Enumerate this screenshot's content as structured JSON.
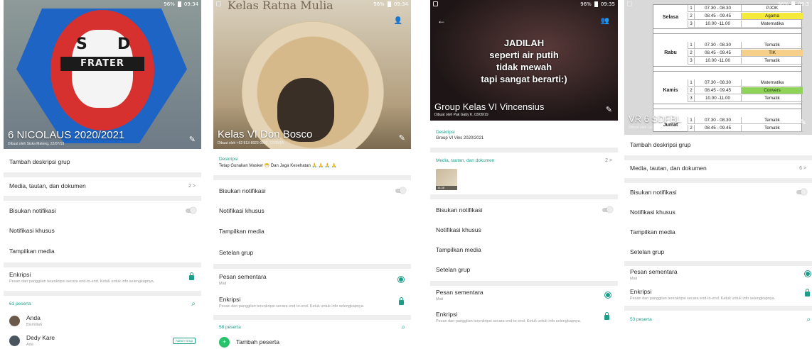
{
  "status": {
    "p1": "96%",
    "p1_time": "09:34",
    "p2": "96%",
    "p2_time": "09:34",
    "p3": "96%",
    "p3_time": "09:35",
    "p4": "96%",
    "p4_time": "09:3"
  },
  "screen1": {
    "logo_s": "S",
    "logo_d": "D",
    "logo_frater": "FRATER",
    "title": "6 NICOLAUS 2020/2021",
    "subtitle": "Dibuat oleh Siska Mateng, 22/07/19",
    "add_description": "Tambah deskripsi grup",
    "media_label": "Media, tautan, dan dokumen",
    "media_count": "2 >",
    "mute": "Bisukan notifikasi",
    "custom_notif": "Notifikasi khusus",
    "show_media": "Tampilkan media",
    "encryption": "Enkripsi",
    "encryption_desc": "Pesan dan panggilan terenkripsi secara end-to-end. Ketuk untuk info selengkapnya.",
    "participants": "61 peserta",
    "members": [
      {
        "name": "Anda",
        "status": "Bismillah"
      },
      {
        "name": "Dedy Kare",
        "status": "Ada",
        "badge": "Admin Grup"
      }
    ]
  },
  "screen2": {
    "top_text": "Kelas Ratna Mulia",
    "title": "Kelas VI Don Bosco",
    "subtitle": "Dibuat oleh +62 813-8923-0932, 12/09/18",
    "desc_label": "Deskripsi",
    "desc_text": "Tetap Gunakan Masker 😷 Dan Jaga Kesehatan 🙏 🙏 🙏 🙏",
    "mute": "Bisukan notifikasi",
    "custom_notif": "Notifikasi khusus",
    "show_media": "Tampilkan media",
    "group_settings": "Setelan grup",
    "disappearing": "Pesan sementara",
    "disappearing_value": "Mati",
    "encryption": "Enkripsi",
    "encryption_desc": "Pesan dan panggilan terenkripsi secara end-to-end. Ketuk untuk info selengkapnya.",
    "participants": "58 peserta",
    "add_participant": "Tambah peserta"
  },
  "screen3": {
    "quote": [
      "JADILAH",
      "seperti air putih",
      "tidak mewah",
      "tapi sangat berarti:)"
    ],
    "title": "Group Kelas VI Vincensius",
    "subtitle": "Dibuat oleh Pak Gaby K, 03/09/19",
    "desc_label": "Deskripsi",
    "desc_text": "Group VI Vins 2020/2021",
    "media_label": "Media, tautan, dan dokumen",
    "media_count": "2 >",
    "media_thumb_label": "16.38",
    "mute": "Bisukan notifikasi",
    "custom_notif": "Notifikasi khusus",
    "show_media": "Tampilkan media",
    "group_settings": "Setelan grup",
    "disappearing": "Pesan sementara",
    "disappearing_value": "Mati",
    "encryption": "Enkripsi",
    "encryption_desc": "Pesan dan panggilan terenkripsi secara end-to-end. Ketuk untuk info selengkapnya."
  },
  "screen4": {
    "schedule": [
      {
        "day": "",
        "rows": [
          [
            "1",
            "07.30 - 08.30",
            "PJOK",
            ""
          ]
        ]
      },
      {
        "day": "Selasa",
        "rows": [
          [
            "2",
            "08.45 - 09.45",
            "Agama",
            "yellow"
          ],
          [
            "3",
            "10.00 -11.00",
            "Matematika",
            ""
          ]
        ]
      },
      {
        "day": "Rabu",
        "rows": [
          [
            "1",
            "07.30 - 08.30",
            "Tematik",
            ""
          ],
          [
            "2",
            "08.45 - 09.45",
            "TIK",
            "orange"
          ],
          [
            "3",
            "10.00 -11.00",
            "Tematik",
            ""
          ]
        ]
      },
      {
        "day": "Kamis",
        "rows": [
          [
            "1",
            "07.30 - 08.30",
            "Matematika",
            ""
          ],
          [
            "2",
            "08.45 - 09.45",
            "Convers",
            "green"
          ],
          [
            "3",
            "10.00 -11.00",
            "Tematik",
            ""
          ]
        ]
      },
      {
        "day": "Jumat",
        "rows": [
          [
            "1",
            "07.30 - 08.30",
            "Tematik",
            ""
          ],
          [
            "2",
            "08.45 - 09.45",
            "Tematik",
            ""
          ]
        ]
      }
    ],
    "title": "VR 6 SDFBL",
    "subtitle": "Dibuat oleh Lal...",
    "add_description": "Tambah deskripsi grup",
    "media_label": "Media, tautan, dan dokumen",
    "media_count": "6 >",
    "mute": "Bisukan notifikasi",
    "custom_notif": "Notifikasi khusus",
    "show_media": "Tampilkan media",
    "group_settings": "Setelan grup",
    "disappearing": "Pesan sementara",
    "disappearing_value": "Mati",
    "encryption": "Enkripsi",
    "encryption_desc": "Pesan dan panggilan terenkripsi secara end-to-end. Ketuk untuk info selengkapnya.",
    "participants": "53 peserta"
  },
  "colors": {
    "accent": "#1e9e8a",
    "separator": "#eeeeee",
    "highlight_yellow": "#f5e93a",
    "highlight_orange": "#f6d08a",
    "highlight_green": "#8fd35a"
  }
}
